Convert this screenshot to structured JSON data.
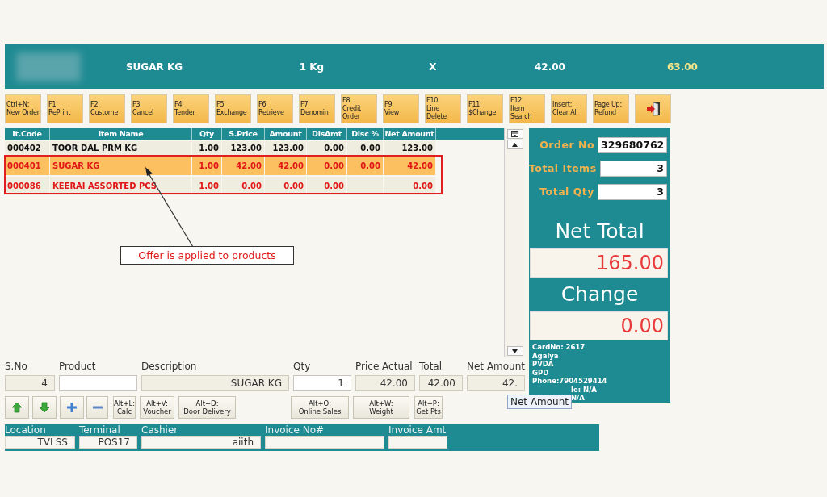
{
  "banner": {
    "item": "SUGAR KG",
    "unit": "1 Kg",
    "multiply": "X",
    "price": "42.00",
    "total": "63.00"
  },
  "toolbar": [
    {
      "kind": "text",
      "key": "Ctrl+N:",
      "label": "New Order"
    },
    {
      "kind": "text",
      "key": "F1:",
      "label": "RePrint"
    },
    {
      "kind": "text",
      "key": "F2:",
      "label": "Custome"
    },
    {
      "kind": "text",
      "key": "F3:",
      "label": "Cancel"
    },
    {
      "kind": "text",
      "key": "F4:",
      "label": "Tender"
    },
    {
      "kind": "text",
      "key": "F5:",
      "label": "Exchange"
    },
    {
      "kind": "text",
      "key": "F6:",
      "label": "Retrieve"
    },
    {
      "kind": "text",
      "key": "F7:",
      "label": "Denomin"
    },
    {
      "kind": "text",
      "key": "F8:",
      "label": "Credit Order"
    },
    {
      "kind": "text",
      "key": "F9:",
      "label": "View"
    },
    {
      "kind": "text",
      "key": "F10:",
      "label": "Line Delete"
    },
    {
      "kind": "text",
      "key": "F11:",
      "label": "$Change"
    },
    {
      "kind": "text",
      "key": "F12:",
      "label": "Item Search"
    },
    {
      "kind": "text",
      "key": "Insert:",
      "label": "Clear All"
    },
    {
      "kind": "text",
      "key": "Page Up:",
      "label": "Refund"
    },
    {
      "kind": "exit"
    }
  ],
  "table": {
    "columns": [
      "It.Code",
      "Item Name",
      "Qty",
      "S.Price",
      "Amount",
      "DisAmt",
      "Disc %",
      "Net Amount"
    ],
    "rows": [
      {
        "selected": false,
        "offer": false,
        "code": "000402",
        "name": "TOOR DAL PRM  KG",
        "qty": "1.00",
        "price": "123.00",
        "amount": "123.00",
        "dis_amt": "0.00",
        "disc_pct": "0.00",
        "net": "123.00"
      },
      {
        "selected": true,
        "offer": true,
        "code": "000401",
        "name": "SUGAR KG",
        "qty": "1.00",
        "price": "42.00",
        "amount": "42.00",
        "dis_amt": "0.00",
        "disc_pct": "0.00",
        "net": "42.00"
      },
      {
        "selected": false,
        "offer": true,
        "code": "000086",
        "name": "KEERAI ASSORTED PCS",
        "qty": "1.00",
        "price": "0.00",
        "amount": "0.00",
        "dis_amt": "0.00",
        "net": "0.00"
      }
    ]
  },
  "annotation": {
    "callout": "Offer is applied to products"
  },
  "summary": {
    "order_no_label": "Order No",
    "order_no": "329680762",
    "total_items_label": "Total Items",
    "total_items": "3",
    "total_qty_label": "Total Qty",
    "total_qty": "3",
    "net_total_label": "Net Total",
    "net_total": "165.00",
    "change_label": "Change",
    "change": "0.00",
    "customer": [
      "CardNo: 2617",
      "Agalya",
      "PVDA",
      "GPD",
      "Phone:7904529414",
      "le: N/A",
      "N/A"
    ]
  },
  "entry": {
    "fields": [
      {
        "label": "S.No",
        "value": "4",
        "kind": "readonly"
      },
      {
        "label": "Product",
        "kind": "input"
      },
      {
        "label": "Description",
        "value": "SUGAR KG",
        "kind": "readonly"
      },
      {
        "label": "Qty",
        "value": "1",
        "kind": "input"
      },
      {
        "label": "Price Actual",
        "value": "42.00",
        "kind": "readonly"
      },
      {
        "label": "Total",
        "value": "42.00",
        "kind": "readonly"
      },
      {
        "label": "Net Amount",
        "value": "42.",
        "kind": "readonly"
      }
    ],
    "buttons": [
      {
        "kind": "up"
      },
      {
        "kind": "down"
      },
      {
        "kind": "plus"
      },
      {
        "kind": "minus"
      },
      {
        "kind": "text",
        "key": "Alt+L:",
        "label": "Calc"
      },
      {
        "kind": "text",
        "key": "Alt+V:",
        "label": "Voucher"
      },
      {
        "kind": "text",
        "key": "Alt+D:",
        "label": "Door Delivery"
      },
      {
        "kind": "text",
        "key": "Alt+O:",
        "label": "Online Sales"
      },
      {
        "kind": "text",
        "key": "Alt+W:",
        "label": "Weight"
      },
      {
        "kind": "text",
        "key": "Alt+P:",
        "label": "Get Pts"
      }
    ]
  },
  "status_bar": [
    {
      "label": "Location",
      "value": "TVLSS"
    },
    {
      "label": "Terminal",
      "value": "POS17"
    },
    {
      "label": "Cashier",
      "value": "aiith"
    },
    {
      "label": "Invoice No#"
    },
    {
      "label": "Invoice Amt"
    }
  ],
  "tooltip": "Net Amount"
}
